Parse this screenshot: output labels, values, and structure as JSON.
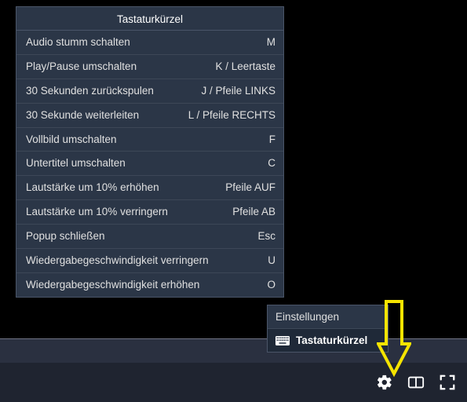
{
  "popup": {
    "title": "Tastaturkürzel",
    "rows": [
      {
        "label": "Audio stumm schalten",
        "key": "M"
      },
      {
        "label": "Play/Pause umschalten",
        "key": "K / Leertaste"
      },
      {
        "label": "30 Sekunden zurückspulen",
        "key": "J / Pfeile LINKS"
      },
      {
        "label": "30 Sekunde weiterleiten",
        "key": "L / Pfeile RECHTS"
      },
      {
        "label": "Vollbild umschalten",
        "key": "F"
      },
      {
        "label": "Untertitel umschalten",
        "key": "C"
      },
      {
        "label": "Lautstärke um 10% erhöhen",
        "key": "Pfeile AUF"
      },
      {
        "label": "Lautstärke um 10% verringern",
        "key": "Pfeile AB"
      },
      {
        "label": "Popup schließen",
        "key": "Esc"
      },
      {
        "label": "Wiedergabegeschwindigkeit verringern",
        "key": "U"
      },
      {
        "label": "Wiedergabegeschwindigkeit erhöhen",
        "key": "O"
      }
    ]
  },
  "submenu": {
    "settings": "Einstellungen",
    "shortcuts": "Tastaturkürzel"
  }
}
